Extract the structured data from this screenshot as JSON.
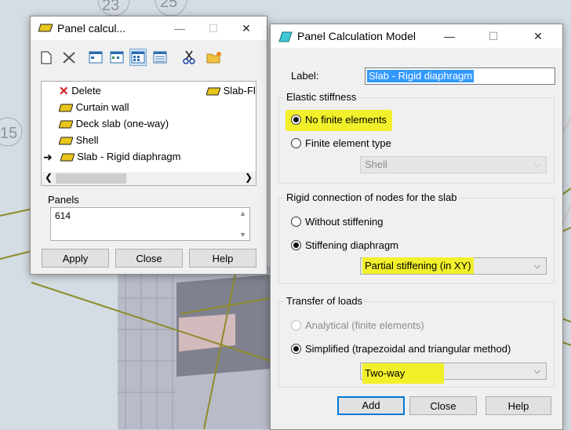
{
  "background": {
    "labels": [
      "23",
      "25",
      "15"
    ]
  },
  "small_window": {
    "title": "Panel calcul...",
    "toolbar_icons": [
      "new-icon",
      "delete-icon",
      "view1-icon",
      "view2-icon",
      "view3-icon",
      "view4-icon",
      "cut-icon",
      "open-folder-icon"
    ],
    "list_items": [
      {
        "label": "Delete",
        "icon": "red-x-icon"
      },
      {
        "label": "Curtain wall",
        "icon": "slab-icon"
      },
      {
        "label": "Deck slab (one-way)",
        "icon": "slab-icon"
      },
      {
        "label": "Shell",
        "icon": "slab-icon"
      },
      {
        "label": "Slab - Rigid diaphragm",
        "icon": "slab-icon",
        "current": true
      }
    ],
    "list_col2": "Slab-Fle",
    "panels_label": "Panels",
    "panels_value": "614",
    "apply_label": "Apply",
    "close_label": "Close",
    "help_label": "Help"
  },
  "main_window": {
    "title": "Panel Calculation Model",
    "label_caption": "Label:",
    "label_value": "Slab - Rigid diaphragm",
    "elastic": {
      "title": "Elastic stiffness",
      "opt1": "No finite elements",
      "opt2": "Finite element type",
      "fe_type": "Shell"
    },
    "rigid": {
      "title": "Rigid connection of nodes for the slab",
      "opt1": "Without stiffening",
      "opt2": "Stiffening diaphragm",
      "stiffening": "Partial stiffening (in XY)"
    },
    "transfer": {
      "title": "Transfer of loads",
      "opt1": "Analytical (finite elements)",
      "opt2": "Simplified (trapezoidal and triangular method)",
      "method": "Two-way"
    },
    "add_label": "Add",
    "close_label": "Close",
    "help_label": "Help"
  },
  "colors": {
    "highlight": "#f2f02a",
    "accent": "#0078d7",
    "selection": "#3399ff"
  }
}
